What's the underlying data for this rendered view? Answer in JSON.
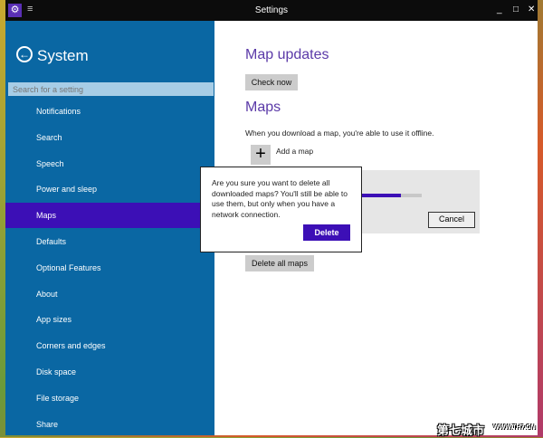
{
  "window": {
    "title": "Settings",
    "minimize": "_",
    "maximize": "□",
    "close": "✕"
  },
  "sidebar": {
    "back_title": "System",
    "search_placeholder": "Search for a setting",
    "items": [
      {
        "label": "Notifications"
      },
      {
        "label": "Search"
      },
      {
        "label": "Speech"
      },
      {
        "label": "Power and sleep"
      },
      {
        "label": "Maps",
        "selected": true
      },
      {
        "label": "Defaults"
      },
      {
        "label": "Optional Features"
      },
      {
        "label": "About"
      },
      {
        "label": "App sizes"
      },
      {
        "label": "Corners and edges"
      },
      {
        "label": "Disk space"
      },
      {
        "label": "File storage"
      },
      {
        "label": "Share"
      }
    ]
  },
  "main": {
    "map_updates_heading": "Map updates",
    "check_now": "Check now",
    "maps_heading": "Maps",
    "maps_desc": "When you download a map, you're able to use it offline.",
    "add_map": "Add a map",
    "download_progress": 0.66,
    "cancel": "Cancel",
    "delete_all": "Delete all maps"
  },
  "dialog": {
    "message": "Are you sure you want to delete all downloaded maps? You'll still be able to use them, but only when you have a network connection.",
    "delete": "Delete"
  },
  "watermark": {
    "cn": "第七城市",
    "url": "WWW.TH7.CN"
  },
  "colors": {
    "accent": "#3c0fb6",
    "sidebar": "#0a67a3",
    "heading": "#5b3aa8"
  }
}
